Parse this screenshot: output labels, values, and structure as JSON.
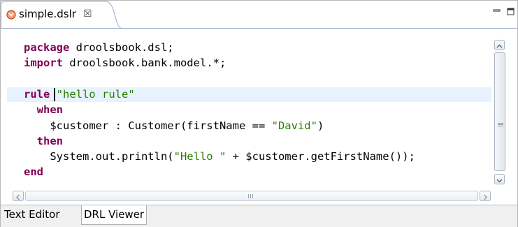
{
  "tab": {
    "title": "simple.dslr",
    "close_glyph": "☒",
    "icon": "drools-file-icon"
  },
  "window_controls": {
    "minimize_icon": "minimize-icon",
    "maximize_icon": "maximize-icon"
  },
  "code": {
    "lines": [
      [
        {
          "t": "package",
          "k": "kw"
        },
        {
          "t": " droolsbook.dsl;",
          "k": ""
        }
      ],
      [
        {
          "t": "import",
          "k": "kw"
        },
        {
          "t": " droolsbook.bank.model.*;",
          "k": ""
        }
      ],
      [],
      [
        {
          "t": "rule",
          "k": "kw"
        },
        {
          "t": " ",
          "k": ""
        },
        {
          "t": "\"hello rule\"",
          "k": "str"
        }
      ],
      [
        {
          "t": "  when",
          "k": "kw"
        }
      ],
      [
        {
          "t": "    $customer : Customer(firstName == ",
          "k": ""
        },
        {
          "t": "\"David\"",
          "k": "str"
        },
        {
          "t": ")",
          "k": ""
        }
      ],
      [
        {
          "t": "  then",
          "k": "kw"
        }
      ],
      [
        {
          "t": "    System.out.println(",
          "k": ""
        },
        {
          "t": "\"Hello \"",
          "k": "str"
        },
        {
          "t": " + $customer.getFirstName());",
          "k": ""
        }
      ],
      [
        {
          "t": "end",
          "k": "kw"
        }
      ]
    ],
    "current_line": 4
  },
  "colors": {
    "keyword": "#7f0055",
    "string": "#2a7d00",
    "current_line_bg": "#e8f2fe"
  },
  "bottom_tabs": {
    "text_editor": "Text Editor",
    "drl_viewer": "DRL Viewer",
    "active": "DRL Viewer"
  }
}
